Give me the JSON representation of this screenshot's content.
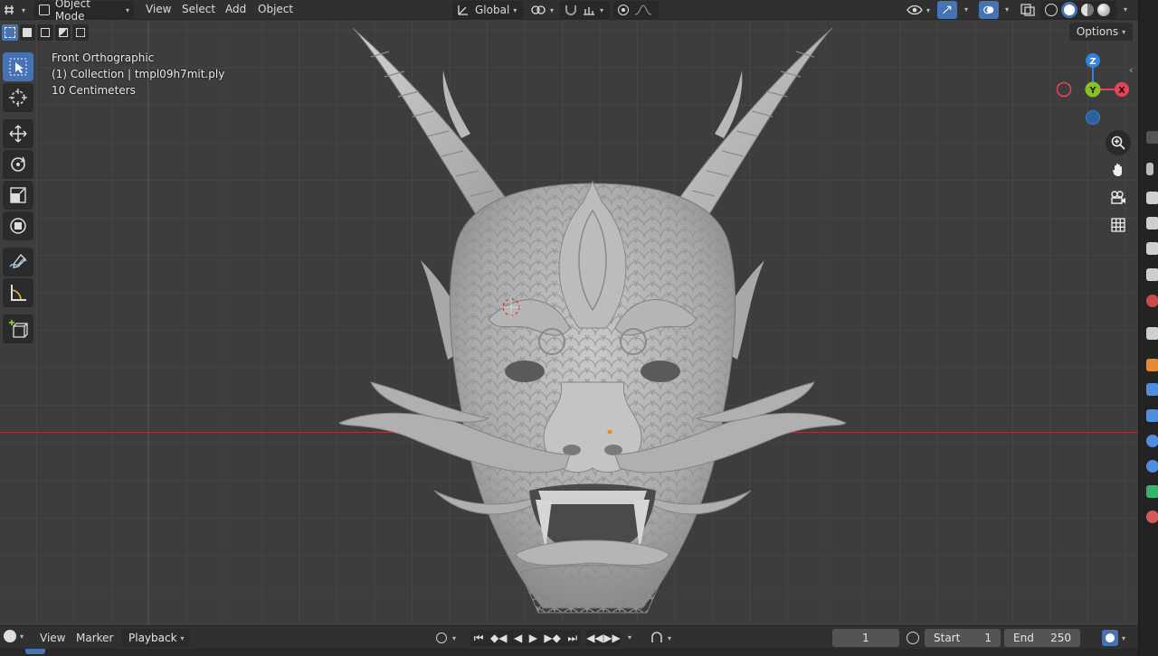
{
  "header": {
    "mode_label": "Object Mode",
    "menus": [
      "View",
      "Select",
      "Add",
      "Object"
    ],
    "transform_orientation": "Global",
    "options_label": "Options"
  },
  "viewport": {
    "view_name": "Front Orthographic",
    "collection_info": "(1) Collection | tmpl09h7mit.ply",
    "scale_info": "10 Centimeters"
  },
  "gizmo": {
    "axis_z": "Z",
    "axis_y": "Y",
    "axis_x": "X",
    "colors": {
      "x": "#e8435a",
      "y": "#8ac224",
      "z": "#2f83e3"
    }
  },
  "tools": [
    "select-box",
    "cursor",
    "move",
    "rotate",
    "scale",
    "transform",
    "annotate",
    "measure",
    "add-cube"
  ],
  "timeline": {
    "menus": [
      "View",
      "Marker",
      "Playback"
    ],
    "current_frame": "1",
    "start_label": "Start",
    "start_value": "1",
    "end_label": "End",
    "end_value": "250"
  }
}
